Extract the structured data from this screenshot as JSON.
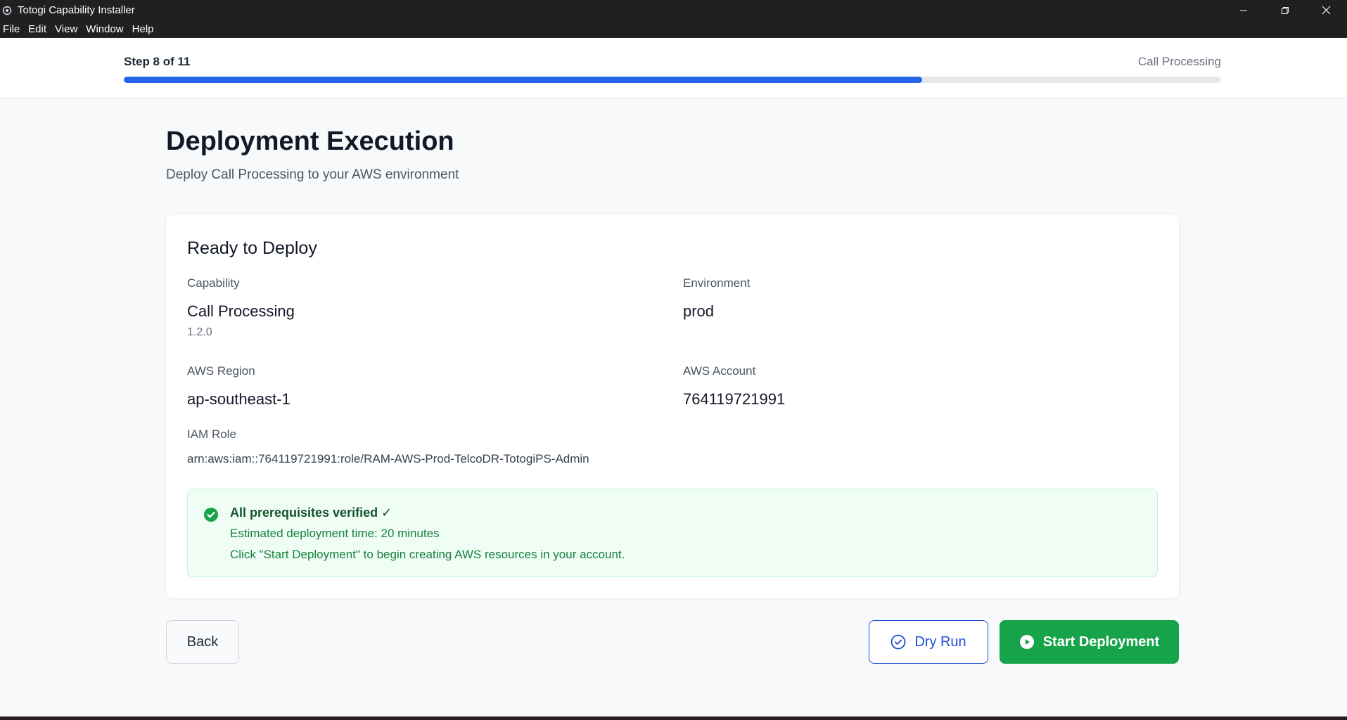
{
  "window": {
    "title": "Totogi Capability Installer"
  },
  "menu": [
    "File",
    "Edit",
    "View",
    "Window",
    "Help"
  ],
  "progress": {
    "step_label": "Step 8 of 11",
    "step_name": "Call Processing",
    "fraction": 0.7273
  },
  "page": {
    "title": "Deployment Execution",
    "subtitle": "Deploy Call Processing to your AWS environment"
  },
  "card": {
    "title": "Ready to Deploy",
    "capability_label": "Capability",
    "capability_value": "Call Processing",
    "capability_version": "1.2.0",
    "environment_label": "Environment",
    "environment_value": "prod",
    "region_label": "AWS Region",
    "region_value": "ap-southeast-1",
    "account_label": "AWS Account",
    "account_value": "764119721991",
    "role_label": "IAM Role",
    "role_value": "arn:aws:iam::764119721991:role/RAM-AWS-Prod-TelcoDR-TotogiPS-Admin"
  },
  "notice": {
    "title": "All prerequisites verified ✓",
    "line1": "Estimated deployment time: 20 minutes",
    "line2": "Click \"Start Deployment\" to begin creating AWS resources in your account."
  },
  "buttons": {
    "back": "Back",
    "dry_run": "Dry Run",
    "start": "Start Deployment"
  },
  "colors": {
    "accent_blue": "#2563eb",
    "success_green": "#16a34a"
  }
}
